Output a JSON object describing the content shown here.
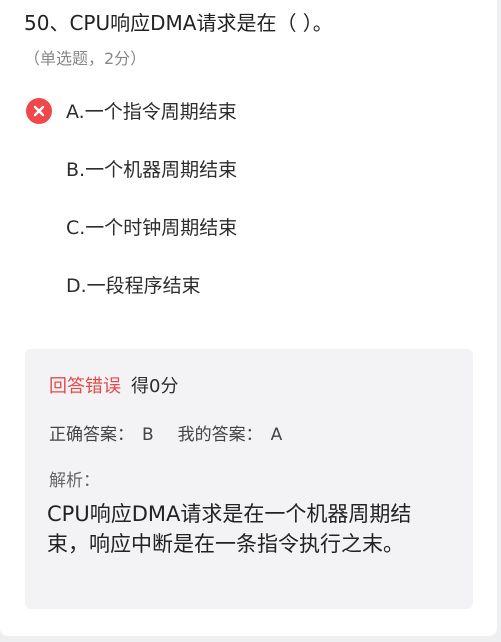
{
  "question": {
    "text": "50、CPU响应DMA请求是在（ ）。",
    "meta": "（单选题，2分）"
  },
  "options": [
    {
      "label": "A.一个指令周期结束",
      "status": "selected-wrong"
    },
    {
      "label": "B.一个机器周期结束"
    },
    {
      "label": "C.一个时钟周期结束"
    },
    {
      "label": "D.一段程序结束"
    }
  ],
  "result": {
    "verdict": "回答错误",
    "score": "得0分",
    "correct_label": "正确答案：",
    "correct_value": "B",
    "mine_label": "我的答案：",
    "mine_value": "A",
    "analysis_label": "解析：",
    "analysis_text": "CPU响应DMA请求是在一个机器周期结束，响应中断是在一条指令执行之末。"
  },
  "icons": {
    "wrong": "close-circle-icon"
  },
  "colors": {
    "error_red": "#f0484a",
    "verdict_red": "#e44a4a",
    "panel_bg": "#f3f3f5"
  }
}
